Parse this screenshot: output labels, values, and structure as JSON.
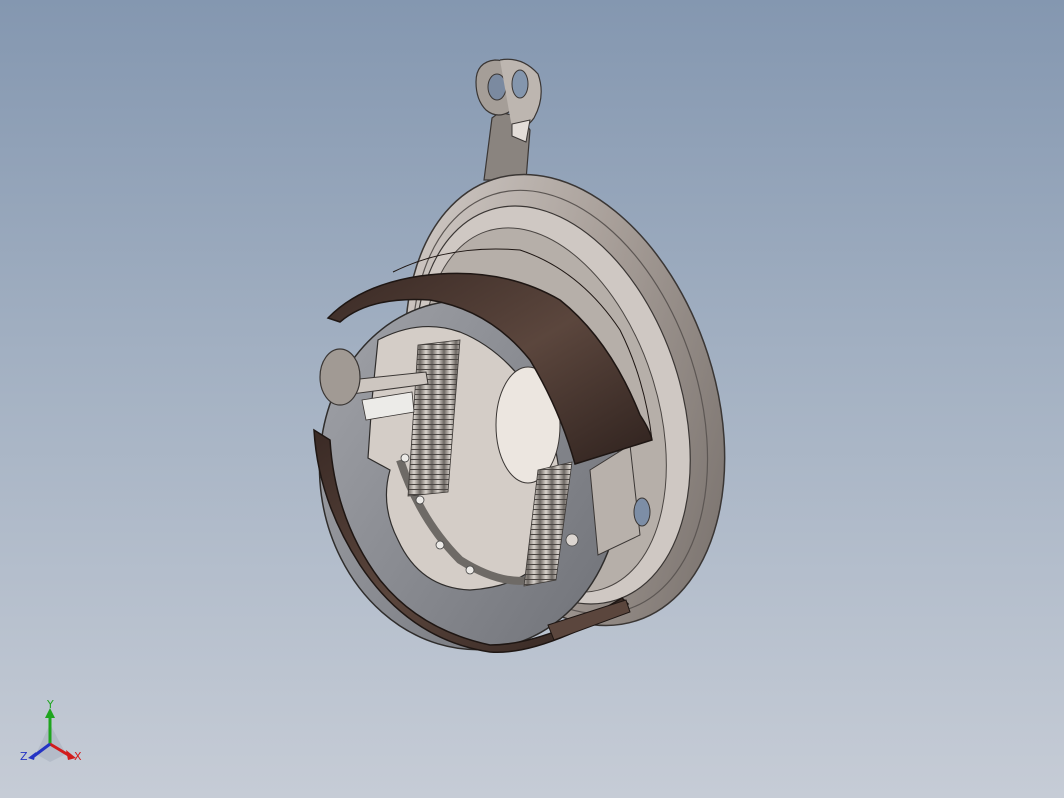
{
  "viewport": {
    "background_top": "#8497b0",
    "background_bottom": "#c6ccd6"
  },
  "model": {
    "description_icon": "brake-drum-assembly-icon",
    "lining_color": "#4e3a33",
    "metal_color": "#b9b1ab",
    "shoe_color": "#8c8d93"
  },
  "triad": {
    "x_label": "X",
    "y_label": "Y",
    "z_label": "Z",
    "x_color": "#d21c1c",
    "y_color": "#1fa51f",
    "z_color": "#2433c4"
  }
}
